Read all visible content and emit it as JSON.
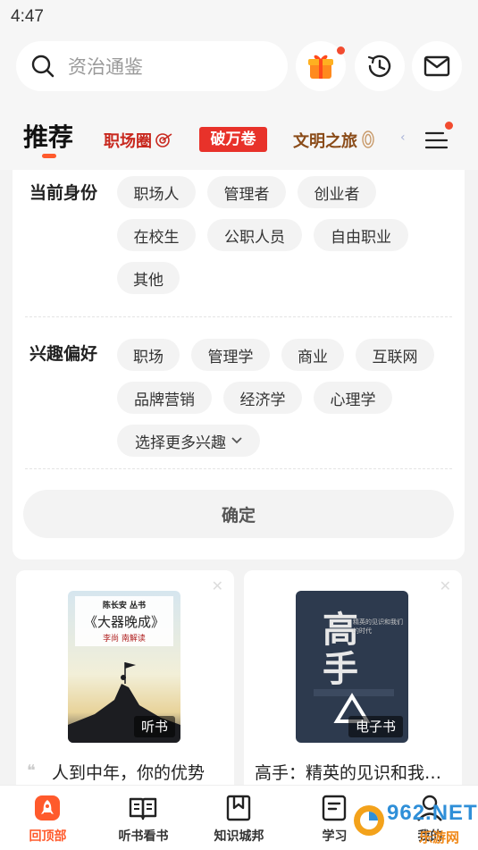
{
  "status_bar": {
    "time": "4:47"
  },
  "search": {
    "placeholder": "资治通鉴",
    "icon": "search-icon"
  },
  "header_actions": {
    "gift": {
      "icon": "gift-icon",
      "has_badge": true
    },
    "history": {
      "icon": "history-icon"
    },
    "mail": {
      "icon": "mail-icon"
    }
  },
  "tabs": {
    "active": "推荐",
    "items": [
      "职场圈",
      "破万卷",
      "文明之旅"
    ],
    "menu_icon": "menu-icon"
  },
  "preferences": {
    "identity": {
      "label": "当前身份",
      "options": [
        "职场人",
        "管理者",
        "创业者",
        "在校生",
        "公职人员",
        "自由职业",
        "其他"
      ]
    },
    "interests": {
      "label": "兴趣偏好",
      "options": [
        "职场",
        "管理学",
        "商业",
        "互联网",
        "品牌营销",
        "经济学",
        "心理学"
      ],
      "more": "选择更多兴趣"
    },
    "confirm": "确定"
  },
  "books": [
    {
      "title": "人到中年，你的优势",
      "badge": "听书",
      "cover_series": "陈长安 丛书",
      "cover_title": "《大器晚成》",
      "cover_author": "李尚 南解读"
    },
    {
      "title": "高手：精英的见识和我…",
      "badge": "电子书",
      "cover_title": "高手",
      "cover_subtitle": "精英的见识和我们的时代"
    }
  ],
  "bottom_nav": [
    {
      "label": "回顶部",
      "icon": "rocket-icon",
      "active": true
    },
    {
      "label": "听书看书",
      "icon": "book-open-icon"
    },
    {
      "label": "知识城邦",
      "icon": "bookmark-icon"
    },
    {
      "label": "学习",
      "icon": "notes-icon"
    },
    {
      "label": "我的",
      "icon": "profile-icon"
    }
  ],
  "watermark": {
    "brand": "962.NET",
    "sub": "乐游网"
  },
  "colors": {
    "accent": "#ff5a2c",
    "brand_red": "#e8322a",
    "chip_bg": "#f3f3f3"
  }
}
